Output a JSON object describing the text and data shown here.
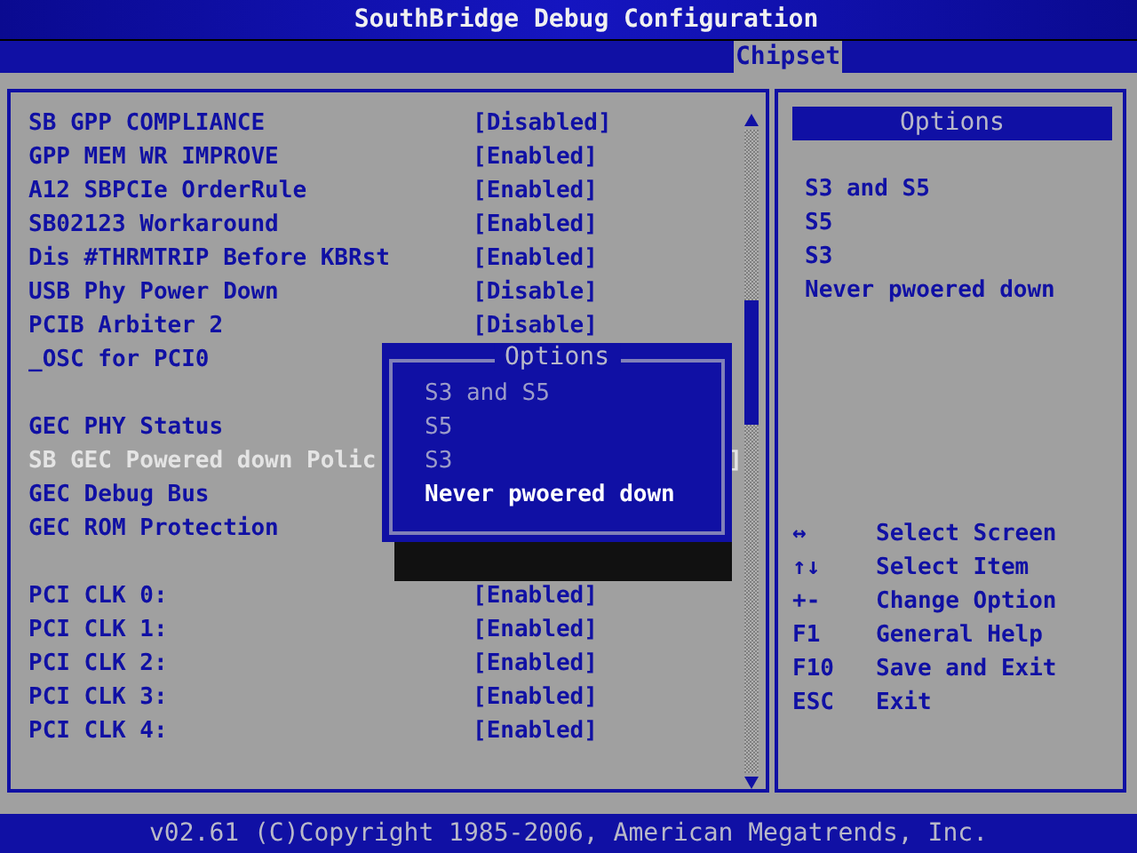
{
  "title": "SouthBridge Debug Configuration",
  "tabs": [
    {
      "label": "Chipset",
      "selected": true
    }
  ],
  "settings": [
    {
      "kind": "setting",
      "label": "SB GPP COMPLIANCE",
      "value": "[Disabled]",
      "selected": false
    },
    {
      "kind": "setting",
      "label": "GPP MEM WR IMPROVE",
      "value": "[Enabled]",
      "selected": false
    },
    {
      "kind": "setting",
      "label": "A12 SBPCIe OrderRule",
      "value": "[Enabled]",
      "selected": false
    },
    {
      "kind": "setting",
      "label": "SB02123 Workaround",
      "value": "[Enabled]",
      "selected": false
    },
    {
      "kind": "setting",
      "label": "Dis #THRMTRIP Before KBRst",
      "value": "[Enabled]",
      "selected": false
    },
    {
      "kind": "setting",
      "label": "USB Phy Power Down",
      "value": "[Disable]",
      "selected": false
    },
    {
      "kind": "setting",
      "label": "PCIB Arbiter 2",
      "value": "[Disable]",
      "selected": false
    },
    {
      "kind": "setting",
      "label": "_OSC for PCI0",
      "selected": false
    },
    {
      "kind": "spacer"
    },
    {
      "kind": "setting",
      "label": "GEC PHY Status",
      "selected": false
    },
    {
      "kind": "setting",
      "label": "SB GEC Powered down Polic",
      "value": "]",
      "value_cut": true,
      "selected": true
    },
    {
      "kind": "setting",
      "label": "GEC Debug Bus",
      "selected": false
    },
    {
      "kind": "setting",
      "label": "GEC ROM Protection",
      "selected": false
    },
    {
      "kind": "spacer"
    },
    {
      "kind": "setting",
      "label": "PCI CLK 0:",
      "value": "[Enabled]",
      "selected": false
    },
    {
      "kind": "setting",
      "label": "PCI CLK 1:",
      "value": "[Enabled]",
      "selected": false
    },
    {
      "kind": "setting",
      "label": "PCI CLK 2:",
      "value": "[Enabled]",
      "selected": false
    },
    {
      "kind": "setting",
      "label": "PCI CLK 3:",
      "value": "[Enabled]",
      "selected": false
    },
    {
      "kind": "setting",
      "label": "PCI CLK 4:",
      "value": "[Enabled]",
      "selected": false
    }
  ],
  "popup": {
    "title": "Options",
    "options": [
      {
        "label": "S3 and S5",
        "selected": false
      },
      {
        "label": "S5",
        "selected": false
      },
      {
        "label": "S3",
        "selected": false
      },
      {
        "label": "Never pwoered down",
        "selected": true
      }
    ]
  },
  "help_panel": {
    "title": "Options",
    "options": [
      "S3 and S5",
      "S5",
      "S3",
      "Never pwoered down"
    ],
    "keys": [
      {
        "key": "↔",
        "action": "Select Screen"
      },
      {
        "key": "↑↓",
        "action": "Select Item"
      },
      {
        "key": "+-",
        "action": "Change Option"
      },
      {
        "key": "F1",
        "action": "General Help"
      },
      {
        "key": "F10",
        "action": "Save and Exit"
      },
      {
        "key": "ESC",
        "action": "Exit"
      }
    ]
  },
  "footer": "v02.61 (C)Copyright 1985-2006, American Megatrends, Inc."
}
